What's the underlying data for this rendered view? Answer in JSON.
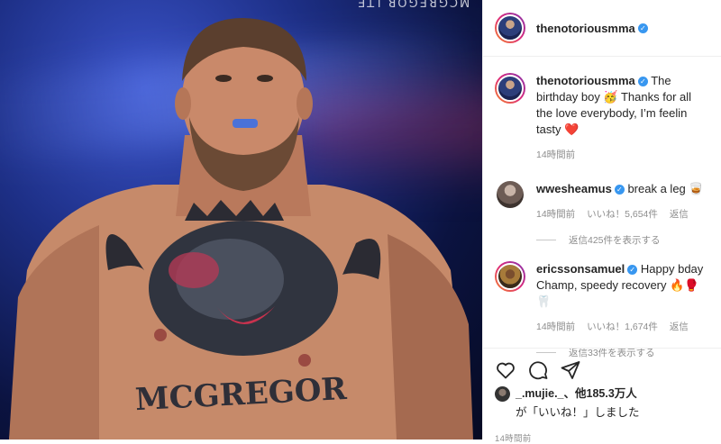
{
  "photo": {
    "watermark": "MCGREGOR.LTE",
    "tattoo_text": "MCGREGOR"
  },
  "header": {
    "username": "thenotoriousmma",
    "verified": true
  },
  "caption": {
    "username": "thenotoriousmma",
    "text": "The birthday boy 🥳 Thanks for all the love everybody, I’m feelin tasty ❤️",
    "time": "14時間前"
  },
  "comments": [
    {
      "username": "wwesheamus",
      "text": "break a leg 🥃",
      "time": "14時間前",
      "likes": "いいね！5,654件",
      "reply": "返信",
      "view_replies": "返信425件を表示する"
    },
    {
      "username": "ericssonsamuel",
      "text": "Happy bday Champ, speedy recovery 🔥🥊🦷",
      "time": "14時間前",
      "likes": "いいね！1,674件",
      "reply": "返信",
      "view_replies": "返信33件を表示する"
    }
  ],
  "footer": {
    "liked_by": "_.mujie._、他185.3万人",
    "liked_suffix": "が「いいね！」しました",
    "time": "14時間前"
  },
  "icons": [
    "heart-icon",
    "comment-icon",
    "share-icon",
    "verified-badge-icon"
  ],
  "colors": {
    "verified": "#3897f0",
    "meta_text": "#8e8e8e",
    "background": "#1d2f86"
  }
}
